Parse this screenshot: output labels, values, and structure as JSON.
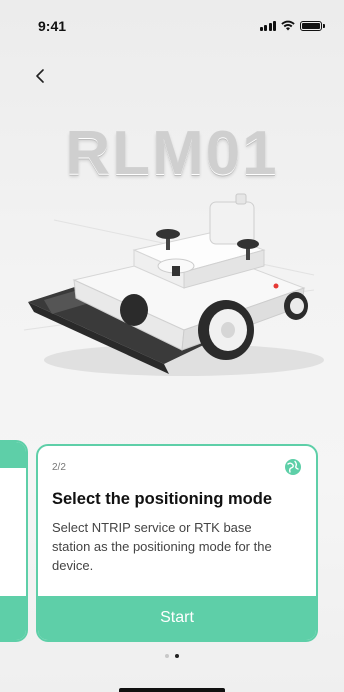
{
  "status_bar": {
    "time": "9:41"
  },
  "header": {
    "back_icon": "chevron-left-icon"
  },
  "hero": {
    "model_name": "RLM01"
  },
  "onboarding": {
    "step": "2/2",
    "title": "Select the positioning mode",
    "description": "Select NTRIP service or RTK base station as the positioning mode for the device.",
    "icon": "globe-icon",
    "start_label": "Start",
    "page_index": 2,
    "page_count": 2
  },
  "colors": {
    "accent": "#5ecfa8",
    "background": "#f3f3f3"
  }
}
